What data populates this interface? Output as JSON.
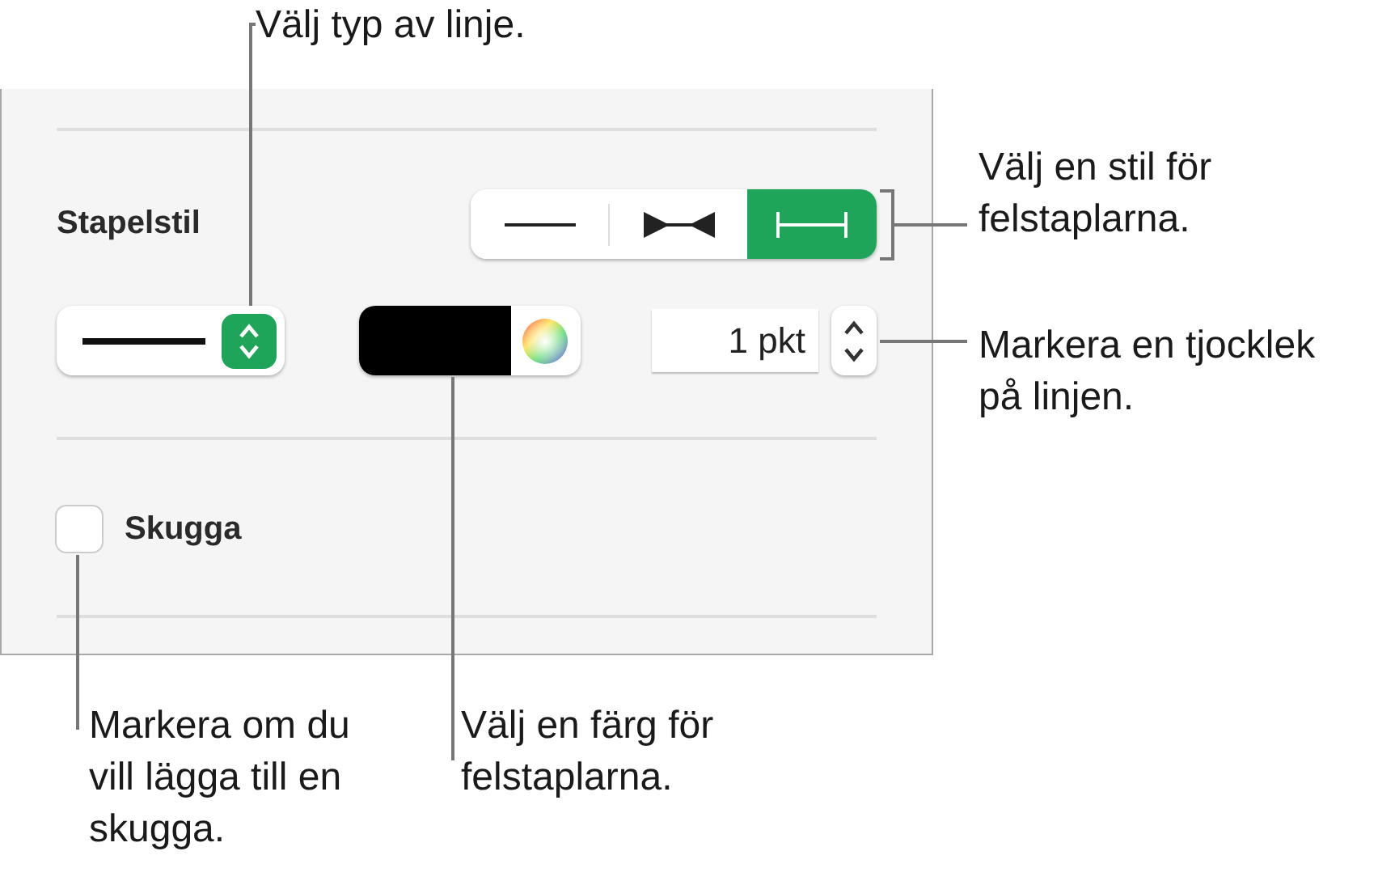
{
  "panel": {
    "title": "Stapelstil",
    "segments": [
      {
        "kind": "plain",
        "selected": false
      },
      {
        "kind": "inward",
        "selected": false
      },
      {
        "kind": "caps",
        "selected": true
      }
    ],
    "thickness": "1 pkt",
    "shadow": {
      "label": "Skugga",
      "checked": false
    }
  },
  "callouts": [
    {
      "kind": "top",
      "text": "Välj typ av linje."
    },
    {
      "kind": "style",
      "text": "Välj en stil för felstaplarna."
    },
    {
      "kind": "thickness",
      "text": "Markera en tjocklek på linjen."
    },
    {
      "kind": "shadow",
      "text": "Markera om du vill lägga till en skugga."
    },
    {
      "kind": "color",
      "text": "Välj en färg för felstaplarna."
    }
  ]
}
